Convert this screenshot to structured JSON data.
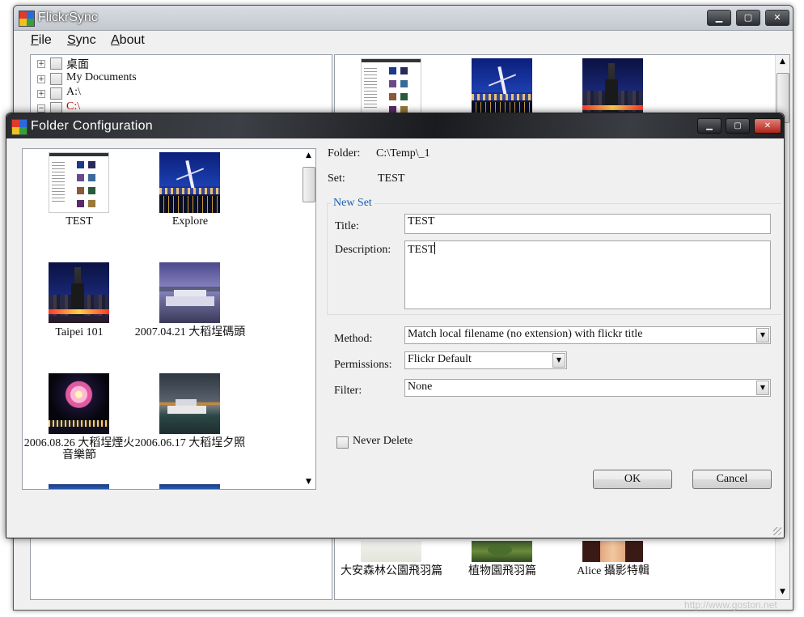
{
  "main_window": {
    "title": "FlickrSync",
    "menu": [
      "File",
      "Sync",
      "About"
    ],
    "tree": [
      {
        "label": "桌面",
        "color": "#000000"
      },
      {
        "label": "My Documents",
        "color": "#000000"
      },
      {
        "label": "A:\\",
        "color": "#000000"
      },
      {
        "label": "C:\\",
        "color": "#cc0000"
      }
    ],
    "gallery_captions": [
      "大安森林公園飛羽篇",
      "植物園飛羽篇",
      "Alice 攝影特輯"
    ]
  },
  "dialog": {
    "title": "Folder  Configuration",
    "photos": [
      "TEST",
      "Explore",
      "Taipei 101",
      "2007.04.21 大稻埕碼頭",
      "2006.08.26 大稻埕煙火音樂節",
      "2006.06.17 大稻埕夕照"
    ],
    "folder_label": "Folder:",
    "folder_value": "C:\\Temp\\_1",
    "set_label": "Set:",
    "set_value": "TEST",
    "group_title": "New Set",
    "title_label": "Title:",
    "title_value": "TEST",
    "description_label": "Description:",
    "description_value": "TEST",
    "method_label": "Method:",
    "method_value": "Match local filename (no extension) with flickr title",
    "permissions_label": "Permissions:",
    "permissions_value": "Flickr Default",
    "filter_label": "Filter:",
    "filter_value": "None",
    "never_delete_label": "Never Delete",
    "never_delete_checked": false,
    "ok_label": "OK",
    "cancel_label": "Cancel"
  },
  "watermark": "http://www.goston.net",
  "colors": {
    "link_blue": "#1a5fb0",
    "drive_red": "#cc0000",
    "close_red": "#c8372c"
  }
}
